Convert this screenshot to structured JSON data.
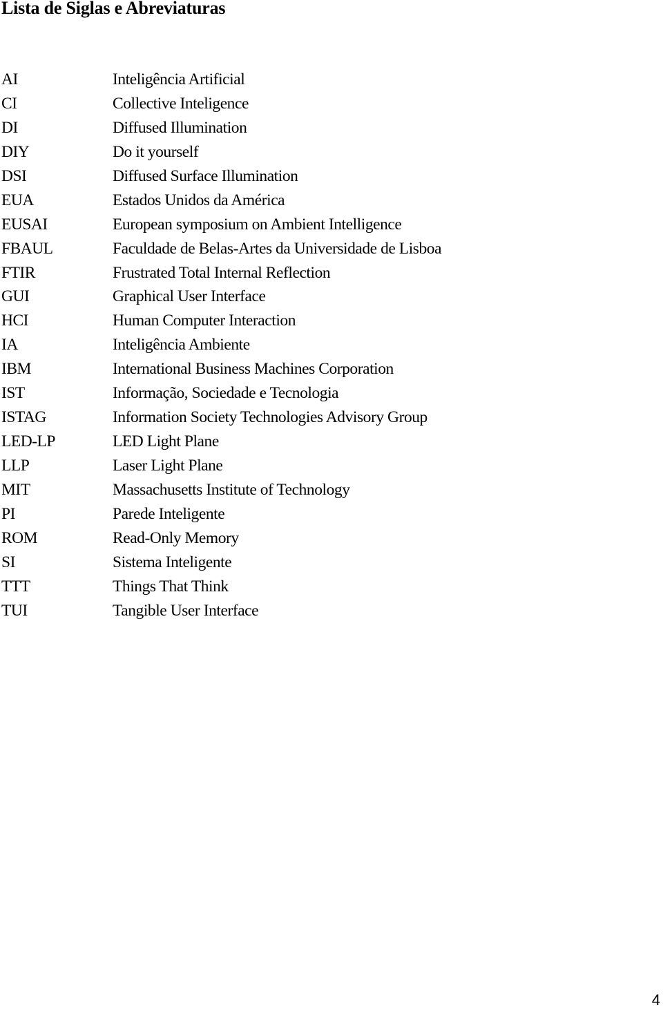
{
  "page": {
    "title": "Lista de Siglas e Abreviaturas",
    "page_number": "4"
  },
  "abbreviations": [
    {
      "acronym": "AI",
      "meaning": "Inteligência Artificial"
    },
    {
      "acronym": "CI",
      "meaning": "Collective Inteligence"
    },
    {
      "acronym": "DI",
      "meaning": "Diffused Illumination"
    },
    {
      "acronym": "DIY",
      "meaning": "Do it yourself"
    },
    {
      "acronym": "DSI",
      "meaning": "Diffused Surface Illumination"
    },
    {
      "acronym": "EUA",
      "meaning": "Estados Unidos da América"
    },
    {
      "acronym": "EUSAI",
      "meaning": "European symposium on Ambient Intelligence"
    },
    {
      "acronym": "FBAUL",
      "meaning": "Faculdade de Belas-Artes da Universidade de Lisboa"
    },
    {
      "acronym": "FTIR",
      "meaning": "Frustrated Total Internal Reflection"
    },
    {
      "acronym": "GUI",
      "meaning": "Graphical User Interface"
    },
    {
      "acronym": "HCI",
      "meaning": "Human Computer Interaction"
    },
    {
      "acronym": "IA",
      "meaning": "Inteligência Ambiente"
    },
    {
      "acronym": "IBM",
      "meaning": "International Business Machines Corporation"
    },
    {
      "acronym": "IST",
      "meaning": "Informação, Sociedade e Tecnologia"
    },
    {
      "acronym": "ISTAG",
      "meaning": "Information Society Technologies Advisory Group"
    },
    {
      "acronym": "LED-LP",
      "meaning": "LED Light Plane"
    },
    {
      "acronym": "LLP",
      "meaning": "Laser Light Plane"
    },
    {
      "acronym": "MIT",
      "meaning": "Massachusetts Institute of Technology"
    },
    {
      "acronym": "PI",
      "meaning": "Parede Inteligente"
    },
    {
      "acronym": "ROM",
      "meaning": "Read-Only Memory"
    },
    {
      "acronym": "SI",
      "meaning": "Sistema Inteligente"
    },
    {
      "acronym": "TTT",
      "meaning": "Things That Think"
    },
    {
      "acronym": "TUI",
      "meaning": "Tangible User Interface"
    }
  ]
}
